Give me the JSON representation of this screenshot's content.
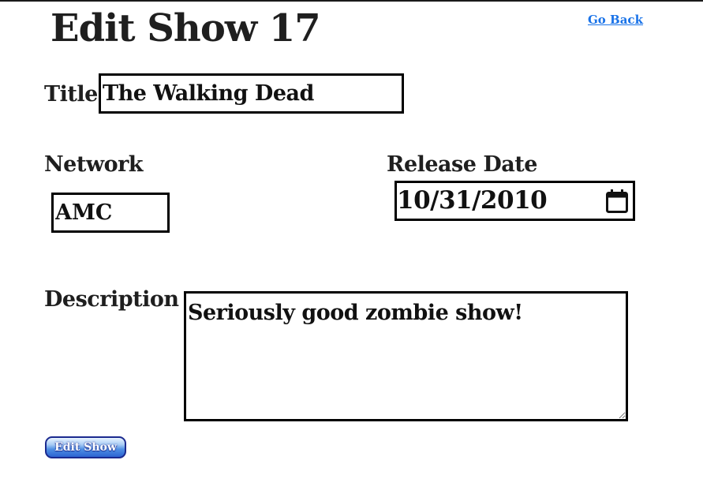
{
  "header": {
    "title": "Edit Show 17",
    "back_link": "Go Back"
  },
  "form": {
    "title": {
      "label": "Title",
      "value": "The Walking Dead"
    },
    "network": {
      "label": "Network",
      "value": "AMC"
    },
    "release_date": {
      "label": "Release Date",
      "value": "10/31/2010"
    },
    "description": {
      "label": "Description",
      "value": "Seriously good zombie show!"
    },
    "submit_label": "Edit Show"
  },
  "colors": {
    "text": "#1f1f1f",
    "link": "#1a73e8",
    "field_border": "#000000",
    "button_border": "#1b2a8f",
    "button_fill": "#4f8fe3"
  },
  "icons": {
    "date_picker": "calendar-icon"
  }
}
